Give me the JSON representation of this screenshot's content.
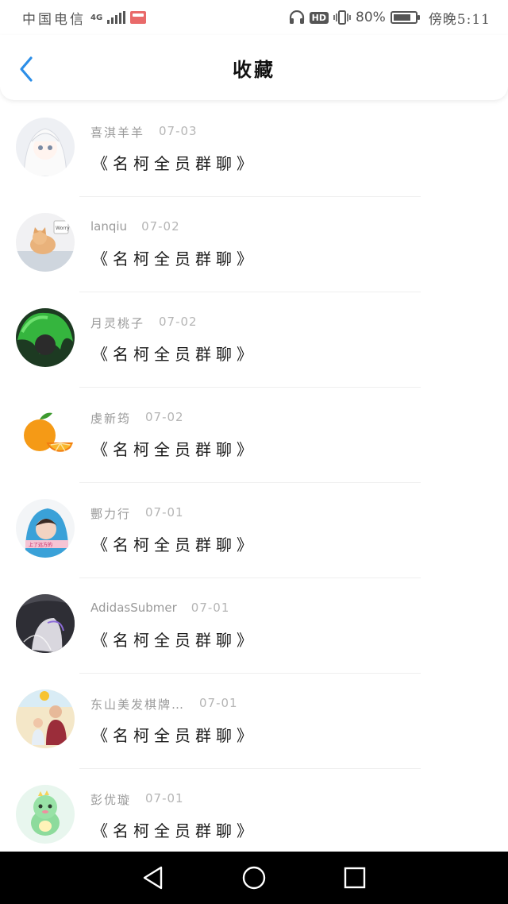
{
  "status_bar": {
    "carrier": "中国电信",
    "network": "4G",
    "battery_percent": "80%",
    "battery_level": 0.8,
    "time": "傍晚5:11",
    "hd_label": "HD"
  },
  "header": {
    "title": "收藏"
  },
  "favorites": [
    {
      "sender": "喜淇羊羊",
      "date": "07-03",
      "content": "《名柯全员群聊》",
      "avatar": "white-hair-anime-girl"
    },
    {
      "sender": "lanqiu",
      "date": "07-02",
      "content": "《名柯全员群聊》",
      "avatar": "kitten-photo"
    },
    {
      "sender": "月灵桃子",
      "date": "07-02",
      "content": "《名柯全员群聊》",
      "avatar": "green-hair-anime"
    },
    {
      "sender": "虔新筠",
      "date": "07-02",
      "content": "《名柯全员群聊》",
      "avatar": "orange-fruit"
    },
    {
      "sender": "酆力行",
      "date": "07-01",
      "content": "《名柯全员群聊》",
      "avatar": "blue-hood-girl"
    },
    {
      "sender": "AdidasSubmer",
      "date": "07-01",
      "content": "《名柯全员群聊》",
      "avatar": "dark-anime-boy"
    },
    {
      "sender": "东山美发棋牌…",
      "date": "07-01",
      "content": "《名柯全员群聊》",
      "avatar": "family-photo"
    },
    {
      "sender": "彭优璇",
      "date": "07-01",
      "content": "《名柯全员群聊》",
      "avatar": "green-dinosaur"
    }
  ],
  "colors": {
    "accent": "#2b8ee8",
    "nav_bg": "#000000",
    "meta_text": "#9a9a9a"
  }
}
